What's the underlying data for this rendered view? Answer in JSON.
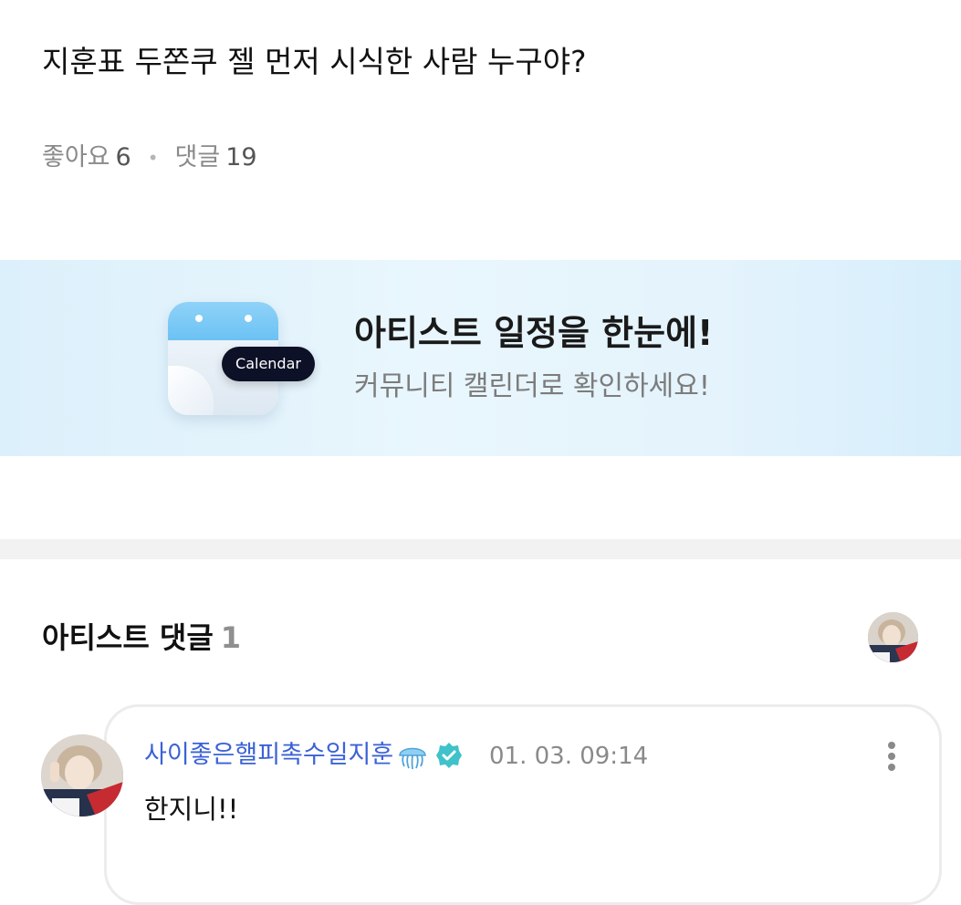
{
  "post": {
    "title": "지훈표 두쫀쿠 젤 먼저 시식한 사람 누구야?",
    "likes_label": "좋아요",
    "likes_count": "6",
    "comments_label": "댓글",
    "comments_count": "19"
  },
  "banner": {
    "pill_label": "Calendar",
    "title": "아티스트 일정을 한눈에!",
    "subtitle": "커뮤니티 캘린더로 확인하세요!"
  },
  "artist_comments": {
    "heading": "아티스트 댓글",
    "count": "1",
    "items": [
      {
        "author": "사이좋은핼피촉수일지훈",
        "timestamp": "01. 03. 09:14",
        "text": "한지니!!"
      }
    ]
  },
  "icons": {
    "verified": "verified-badge-icon",
    "jellyfish": "jellyfish-icon",
    "more": "more-vertical-icon"
  },
  "colors": {
    "author_link": "#3b62d6",
    "verified_badge": "#3fc2c9",
    "calendar_pill": "#0d1127",
    "banner_bg": "#e4f3fc"
  }
}
